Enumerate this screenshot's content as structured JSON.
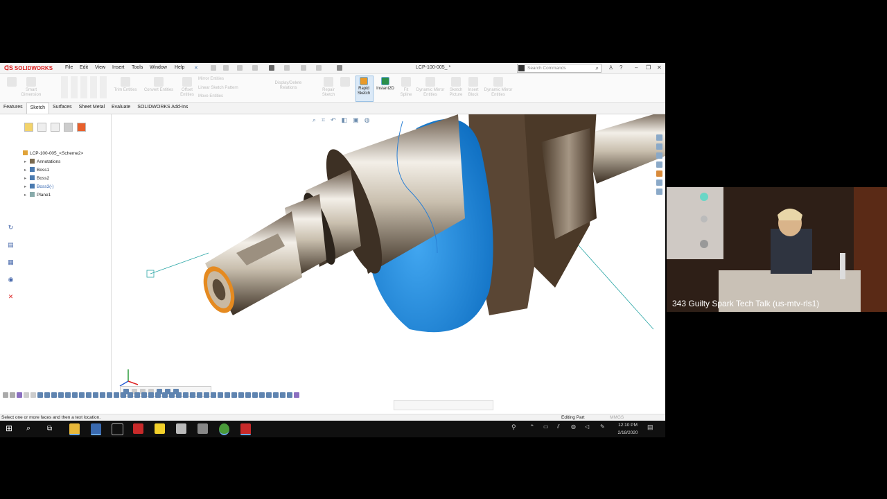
{
  "app": {
    "name": "SOLIDWORKS",
    "document_title": "LCP-100-005_ *"
  },
  "menu": [
    "File",
    "Edit",
    "View",
    "Insert",
    "Tools",
    "Window",
    "Help"
  ],
  "search": {
    "placeholder": "Search Commands"
  },
  "ribbon": {
    "smart_dimension": "Smart Dimension",
    "trim_entities": "Trim Entities",
    "convert_entities": "Convert Entities",
    "offset_entities": "Offset Entities",
    "mirror_entities": "Mirror Entities",
    "linear_sketch_pattern": "Linear Sketch Pattern",
    "move_entities": "Move Entities",
    "display_delete_relations": "Display/Delete Relations",
    "repair_sketch": "Repair Sketch",
    "rapid_sketch": "Rapid Sketch",
    "instant2d": "Instant2D",
    "fit_spline": "Fit Spline",
    "dynamic_mirror": "Dynamic Mirror Entities",
    "sketch_picture": "Sketch Picture",
    "insert_block": "Insert Block",
    "dynamic_mirror_2": "Dynamic Mirror Entities"
  },
  "tabs": [
    "Features",
    "Sketch",
    "Surfaces",
    "Sheet Metal",
    "Evaluate",
    "SOLIDWORKS Add-Ins"
  ],
  "active_tab": "Sketch",
  "tree": {
    "root": "LCP-100-005_<Scheme2>",
    "items": [
      {
        "label": "Annotations",
        "icon": "annotations-icon"
      },
      {
        "label": "Boss1",
        "icon": "feature-icon"
      },
      {
        "label": "Boss2",
        "icon": "feature-icon"
      },
      {
        "label": "Boss3(-)",
        "icon": "feature-icon"
      },
      {
        "label": "Plane1",
        "icon": "plane-icon"
      }
    ]
  },
  "status": {
    "message": "Select one or more faces and then a text location.",
    "mode": "Editing Part",
    "units": "MMGS"
  },
  "clock": {
    "time": "12:10 PM",
    "date": "2/18/2020"
  },
  "webcam": {
    "title": "343 Guilty Spark Tech Talk (us-mtv-rls1)"
  },
  "colors": {
    "selection_blue": "#1f8fe6",
    "sketch_teal": "#2aa6a6",
    "brand_red": "#d22222"
  }
}
